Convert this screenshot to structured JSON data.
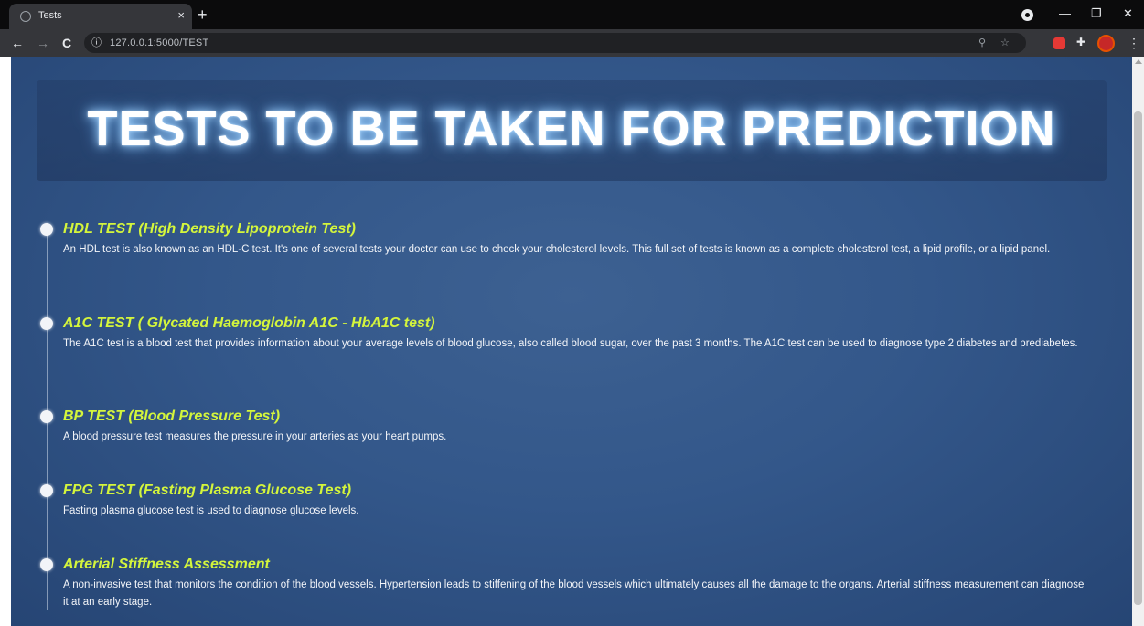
{
  "browser": {
    "tab_title": "Tests",
    "tab_close": "×",
    "new_tab": "+",
    "url": "127.0.0.1:5000/TEST",
    "window_controls": {
      "minimize": "—",
      "maximize": "❐",
      "close": "✕"
    },
    "nav": {
      "back": "←",
      "forward": "→",
      "reload": "C"
    },
    "icons": [
      "info-icon",
      "zoom-icon",
      "star-icon",
      "extension-red-icon",
      "puzzle-icon",
      "profile-avatar",
      "menu-dots-icon"
    ]
  },
  "page": {
    "title": "TESTS TO BE TAKEN FOR PREDICTION",
    "tests": [
      {
        "heading": "HDL TEST (High Density Lipoprotein Test)",
        "description": "An HDL test is also known as an HDL-C test. It's one of several tests your doctor can use to check your cholesterol levels. This full set of tests is known as a complete cholesterol test, a lipid profile, or a lipid panel."
      },
      {
        "heading": "A1C TEST ( Glycated Haemoglobin A1C - HbA1C test)",
        "description": "The A1C test is a blood test that provides information about your average levels of blood glucose, also called blood sugar, over the past 3 months. The A1C test can be used to diagnose type 2 diabetes and prediabetes."
      },
      {
        "heading": "BP TEST (Blood Pressure Test)",
        "description": "A blood pressure test measures the pressure in your arteries as your heart pumps."
      },
      {
        "heading": "FPG TEST (Fasting Plasma Glucose Test)",
        "description": "Fasting plasma glucose test is used to diagnose glucose levels."
      },
      {
        "heading": "Arterial Stiffness Assessment",
        "description": "A non-invasive test that monitors the condition of the blood vessels. Hypertension leads to stiffening of the blood vessels which ultimately causes all the damage to the organs. Arterial stiffness measurement can diagnose it at an early stage."
      }
    ]
  },
  "colors": {
    "background": "#33578a",
    "heading_accent": "#d4f53c",
    "title_glow": "#a9d8ff"
  }
}
